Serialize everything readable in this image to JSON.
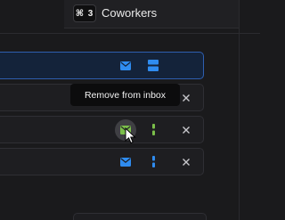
{
  "topbar": {
    "shortcut": "⌘ 3",
    "label": "Coworkers"
  },
  "tooltip": {
    "text": "Remove from inbox"
  },
  "rows": [
    {
      "state": "selected",
      "mail_icon": "mail-icon",
      "status_icon": "stacked-bars-icon",
      "accent": "#2f8cf0"
    },
    {
      "state": "normal",
      "close_icon": "close-icon"
    },
    {
      "state": "hovered",
      "mail_icon": "mail-icon",
      "status_icon": "vertical-bar-icon",
      "close_icon": "close-icon",
      "accent": "#7bbf4a"
    },
    {
      "state": "normal",
      "mail_icon": "mail-icon",
      "status_icon": "vertical-bar-icon",
      "close_icon": "close-icon",
      "accent": "#2f8cf0"
    }
  ],
  "colors": {
    "background": "#1a1a1c",
    "selected_border": "#2e5fb0",
    "blue": "#2f8cf0",
    "green": "#7bbf4a"
  }
}
